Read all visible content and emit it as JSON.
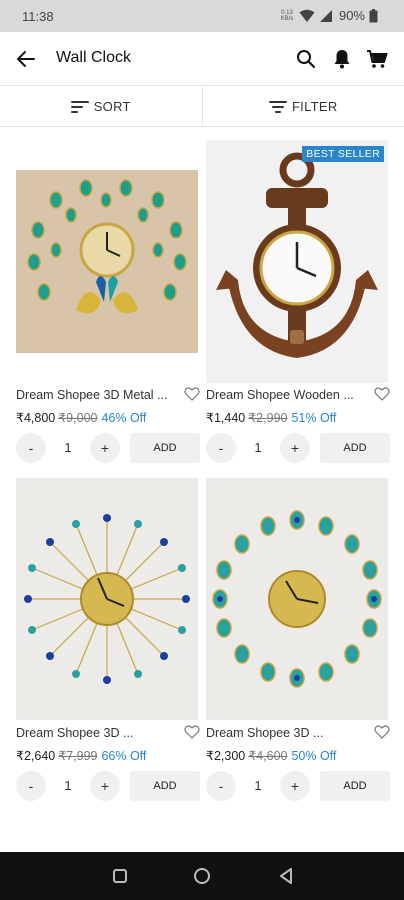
{
  "status_bar": {
    "time": "11:38",
    "net_speed_value": "0.13",
    "net_speed_unit": "KB/s",
    "battery": "90%"
  },
  "app_bar": {
    "title": "Wall Clock",
    "icons": [
      "back-arrow-icon",
      "search-icon",
      "bell-icon",
      "cart-icon"
    ]
  },
  "toolbar": {
    "sort_label": "SORT",
    "filter_label": "FILTER"
  },
  "products": [
    {
      "name": "Dream Shopee 3D Metal ...",
      "price": "₹4,800",
      "mrp": "₹9,000",
      "discount": "46% Off",
      "quantity": "1",
      "minus_label": "-",
      "plus_label": "+",
      "add_label": "ADD",
      "badge": ""
    },
    {
      "name": "Dream Shopee Wooden ...",
      "price": "₹1,440",
      "mrp": "₹2,990",
      "discount": "51% Off",
      "quantity": "1",
      "minus_label": "-",
      "plus_label": "+",
      "add_label": "ADD",
      "badge": "BEST SELLER"
    },
    {
      "name": "Dream Shopee 3D ...",
      "price": "₹2,640",
      "mrp": "₹7,999",
      "discount": "66% Off",
      "quantity": "1",
      "minus_label": "-",
      "plus_label": "+",
      "add_label": "ADD",
      "badge": ""
    },
    {
      "name": "Dream Shopee 3D ...",
      "price": "₹2,300",
      "mrp": "₹4,600",
      "discount": "50% Off",
      "quantity": "1",
      "minus_label": "-",
      "plus_label": "+",
      "add_label": "ADD",
      "badge": ""
    }
  ],
  "colors": {
    "accent_blue": "#2a86c8",
    "status_bar": "#d9d9d9",
    "nav_bar": "#111111"
  }
}
